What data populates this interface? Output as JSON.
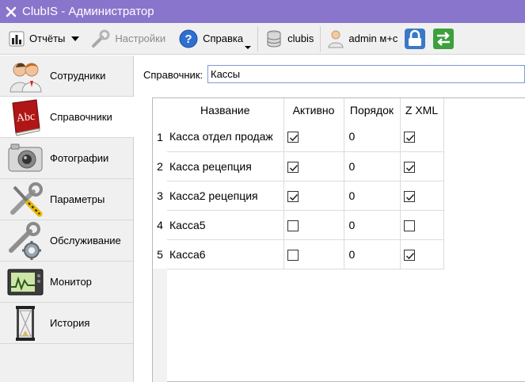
{
  "window": {
    "title": "ClubIS - Администратор"
  },
  "toolbar": {
    "reports_label": "Отчёты",
    "settings_label": "Настройки",
    "help_label": "Справка",
    "db_label": "clubis",
    "user_label": "admin м+с"
  },
  "sidebar": {
    "items": [
      {
        "label": "Сотрудники",
        "icon": "users-icon"
      },
      {
        "label": "Справочники",
        "icon": "dictionary-book-icon"
      },
      {
        "label": "Фотографии",
        "icon": "camera-icon"
      },
      {
        "label": "Параметры",
        "icon": "tools-icon"
      },
      {
        "label": "Обслуживание",
        "icon": "wrench-gear-icon"
      },
      {
        "label": "Монитор",
        "icon": "monitor-icon"
      },
      {
        "label": "История",
        "icon": "hourglass-icon"
      }
    ]
  },
  "filter": {
    "label": "Справочник:",
    "value": "Кассы"
  },
  "table": {
    "headers": [
      "Название",
      "Активно",
      "Порядок",
      "Z XML"
    ],
    "rows": [
      {
        "num": "1",
        "name": "Касса отдел продаж",
        "active": true,
        "order": "0",
        "zxml": true
      },
      {
        "num": "2",
        "name": "Касса рецепция",
        "active": true,
        "order": "0",
        "zxml": true
      },
      {
        "num": "3",
        "name": "Касса2 рецепция",
        "active": true,
        "order": "0",
        "zxml": true
      },
      {
        "num": "4",
        "name": "Касса5",
        "active": false,
        "order": "0",
        "zxml": false
      },
      {
        "num": "5",
        "name": "Касса6",
        "active": false,
        "order": "0",
        "zxml": true
      }
    ]
  },
  "colors": {
    "titlebar": "#8a75cc",
    "accent_input_border": "#7a9cd3"
  }
}
